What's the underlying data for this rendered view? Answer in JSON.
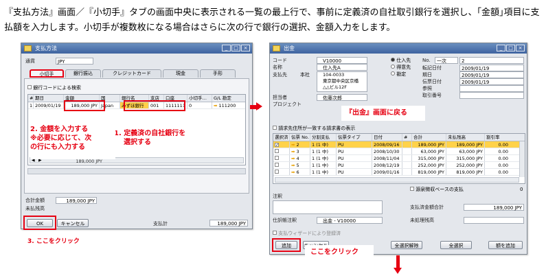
{
  "instruction": {
    "text": "『支払方法』画面／『小切手』タブの画面中央に表示される一覧の最上行で、事前に定義済の自社取引銀行を選択し、｢金額｣項目に支払額を入力します。小切手が複数枚になる場合はさらに次の行で銀行の選択、金額入力をします。"
  },
  "payment_window": {
    "title": "支払方法",
    "currency_label": "通貨",
    "currency_value": "JPY",
    "tabs": [
      {
        "label": "小切手"
      },
      {
        "label": "銀行振込"
      },
      {
        "label": "クレジットカード"
      },
      {
        "label": "現金"
      },
      {
        "label": "手形"
      }
    ],
    "bank_code_checkbox": "銀行コードによる検索",
    "table_headers": [
      "#",
      "期日",
      "金額",
      "国",
      "銀行名",
      "支店",
      "口座",
      "小切手…",
      "G/L 勘定"
    ],
    "row": {
      "num": "1",
      "date": "2009/01/19",
      "amount": "189,000 JPY",
      "country": "Japan",
      "bank": "みずほ銀行",
      "branch": "001",
      "account": "1111111",
      "check_no": "0",
      "gl": "111200"
    },
    "subtotal": "189,000 JPY",
    "total_label": "合計金額",
    "total_value": "189,000 JPY",
    "unpaid_label": "未払残高",
    "payment_label": "支払計",
    "payment_value": "189,000 JPY",
    "ok_button": "OK",
    "cancel_button": "キャンセル"
  },
  "notes": {
    "note1_line1": "1. 定義済の自社銀行を",
    "note1_line2": "選択する",
    "note2_line1": "2. 金額を入力する",
    "note2_line2": "※必要に応じて、次",
    "note2_line3": "の行にも入力する",
    "note3": "3. ここをクリック",
    "back_note": "『出金』画面に戻る",
    "click_note": "ここをクリック"
  },
  "outgoing_window": {
    "title": "出金",
    "code_label": "コード",
    "code_value": "V10000",
    "name_label": "名称",
    "name_value": "仕入先A",
    "address_label": "支払先",
    "address_select": "本社",
    "address_lines": [
      "104-0033",
      "東京都中央区京橋",
      "△△ビル12F"
    ],
    "radio_vendor": "仕入先",
    "radio_account": "勘定",
    "radio_other": "得意先",
    "no_label": "No.",
    "no_type": "一次",
    "no_value": "2",
    "posting_date_label": "転記日付",
    "posting_date": "2009/01/19",
    "due_date_label": "期日",
    "due_date": "2009/01/19",
    "doc_date_label": "伝票日付",
    "doc_date": "2009/01/19",
    "reference_label": "参照",
    "transaction_label": "取引番号",
    "contact_label": "担当者",
    "contact_value": "佐藤次郎",
    "project_label": "プロジェクト",
    "invoice_checkbox": "請求先住所が一致する請求書の表示",
    "table_headers": [
      "選択済",
      "伝票 No.",
      "分割支払",
      "伝票タイプ",
      "日付",
      "#",
      "合計",
      "未払残高",
      "割引率"
    ],
    "rows": [
      {
        "sel": true,
        "doc": "2",
        "split": "1 (1 中)",
        "type": "PU",
        "date": "2008/09/16",
        "total": "189,000 JPY",
        "balance": "189,000 JPY",
        "disc": "0.00"
      },
      {
        "sel": false,
        "doc": "3",
        "split": "1 (1 中)",
        "type": "PU",
        "date": "2008/10/30",
        "total": "63,000 JPY",
        "balance": "63,000 JPY",
        "disc": "0.00"
      },
      {
        "sel": false,
        "doc": "4",
        "split": "1 (1 中)",
        "type": "PU",
        "date": "2008/11/04",
        "total": "315,000 JPY",
        "balance": "315,000 JPY",
        "disc": "0.00"
      },
      {
        "sel": false,
        "doc": "5",
        "split": "1 (1 中)",
        "type": "PU",
        "date": "2008/12/19",
        "total": "252,000 JPY",
        "balance": "252,000 JPY",
        "disc": "0.00"
      },
      {
        "sel": false,
        "doc": "6",
        "split": "1 (1 中)",
        "type": "PU",
        "date": "2009/01/16",
        "total": "819,000 JPY",
        "balance": "819,000 JPY",
        "disc": "0.00"
      }
    ],
    "deduction_checkbox": "源泉徴収ベースの支払",
    "deduction_value": "0",
    "remarks_label": "注釈",
    "total_payment_label": "支払済金額合計",
    "total_payment_value": "189,000 JPY",
    "journal_label": "仕訳帳注釈",
    "journal_value": "出金 - V10000",
    "unprocessed_label": "未処理残高",
    "wizard_checkbox": "支払ウィザードにより登録済",
    "add_button": "追加",
    "cancel_button": "キャンセル",
    "clear_all_button": "全選択解除",
    "select_all_button": "全選択",
    "recalc_button": "額を追加"
  }
}
